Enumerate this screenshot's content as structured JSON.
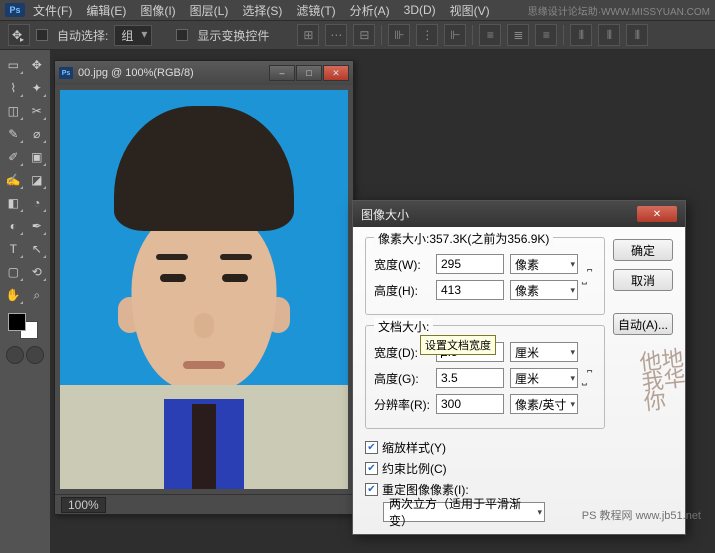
{
  "menubar": {
    "logo": "Ps",
    "items": [
      "文件(F)",
      "编辑(E)",
      "图像(I)",
      "图层(L)",
      "选择(S)",
      "滤镜(T)",
      "分析(A)",
      "3D(D)",
      "视图(V)"
    ],
    "watermark": "思缘设计论坛助·WWW.MISSYUAN.COM"
  },
  "options": {
    "auto_select": "自动选择:",
    "group": "组",
    "show_transform": "显示变换控件"
  },
  "doc_window": {
    "title": "00.jpg @ 100%(RGB/8)",
    "zoom": "100%"
  },
  "dialog": {
    "title": "图像大小",
    "pixel_dim_label": "像素大小:357.3K(之前为356.9K)",
    "width_w": "宽度(W):",
    "height_h": "高度(H):",
    "width_px": "295",
    "height_px": "413",
    "unit_px": "像素",
    "doc_size_label": "文档大小:",
    "width_d": "宽度(D):",
    "height_g": "高度(G):",
    "res_r": "分辨率(R):",
    "width_cm": "2.5",
    "height_cm": "3.5",
    "unit_cm": "厘米",
    "res_val": "300",
    "unit_res": "像素/英寸",
    "scale_styles": "缩放样式(Y)",
    "constrain": "约束比例(C)",
    "resample": "重定图像像素(I):",
    "resample_method": "两次立方（适用于平滑渐变）",
    "ok": "确定",
    "cancel": "取消",
    "auto": "自动(A)..."
  },
  "tooltip": "设置文档宽度",
  "watermark2": "PS 教程网  www.jb51.net"
}
